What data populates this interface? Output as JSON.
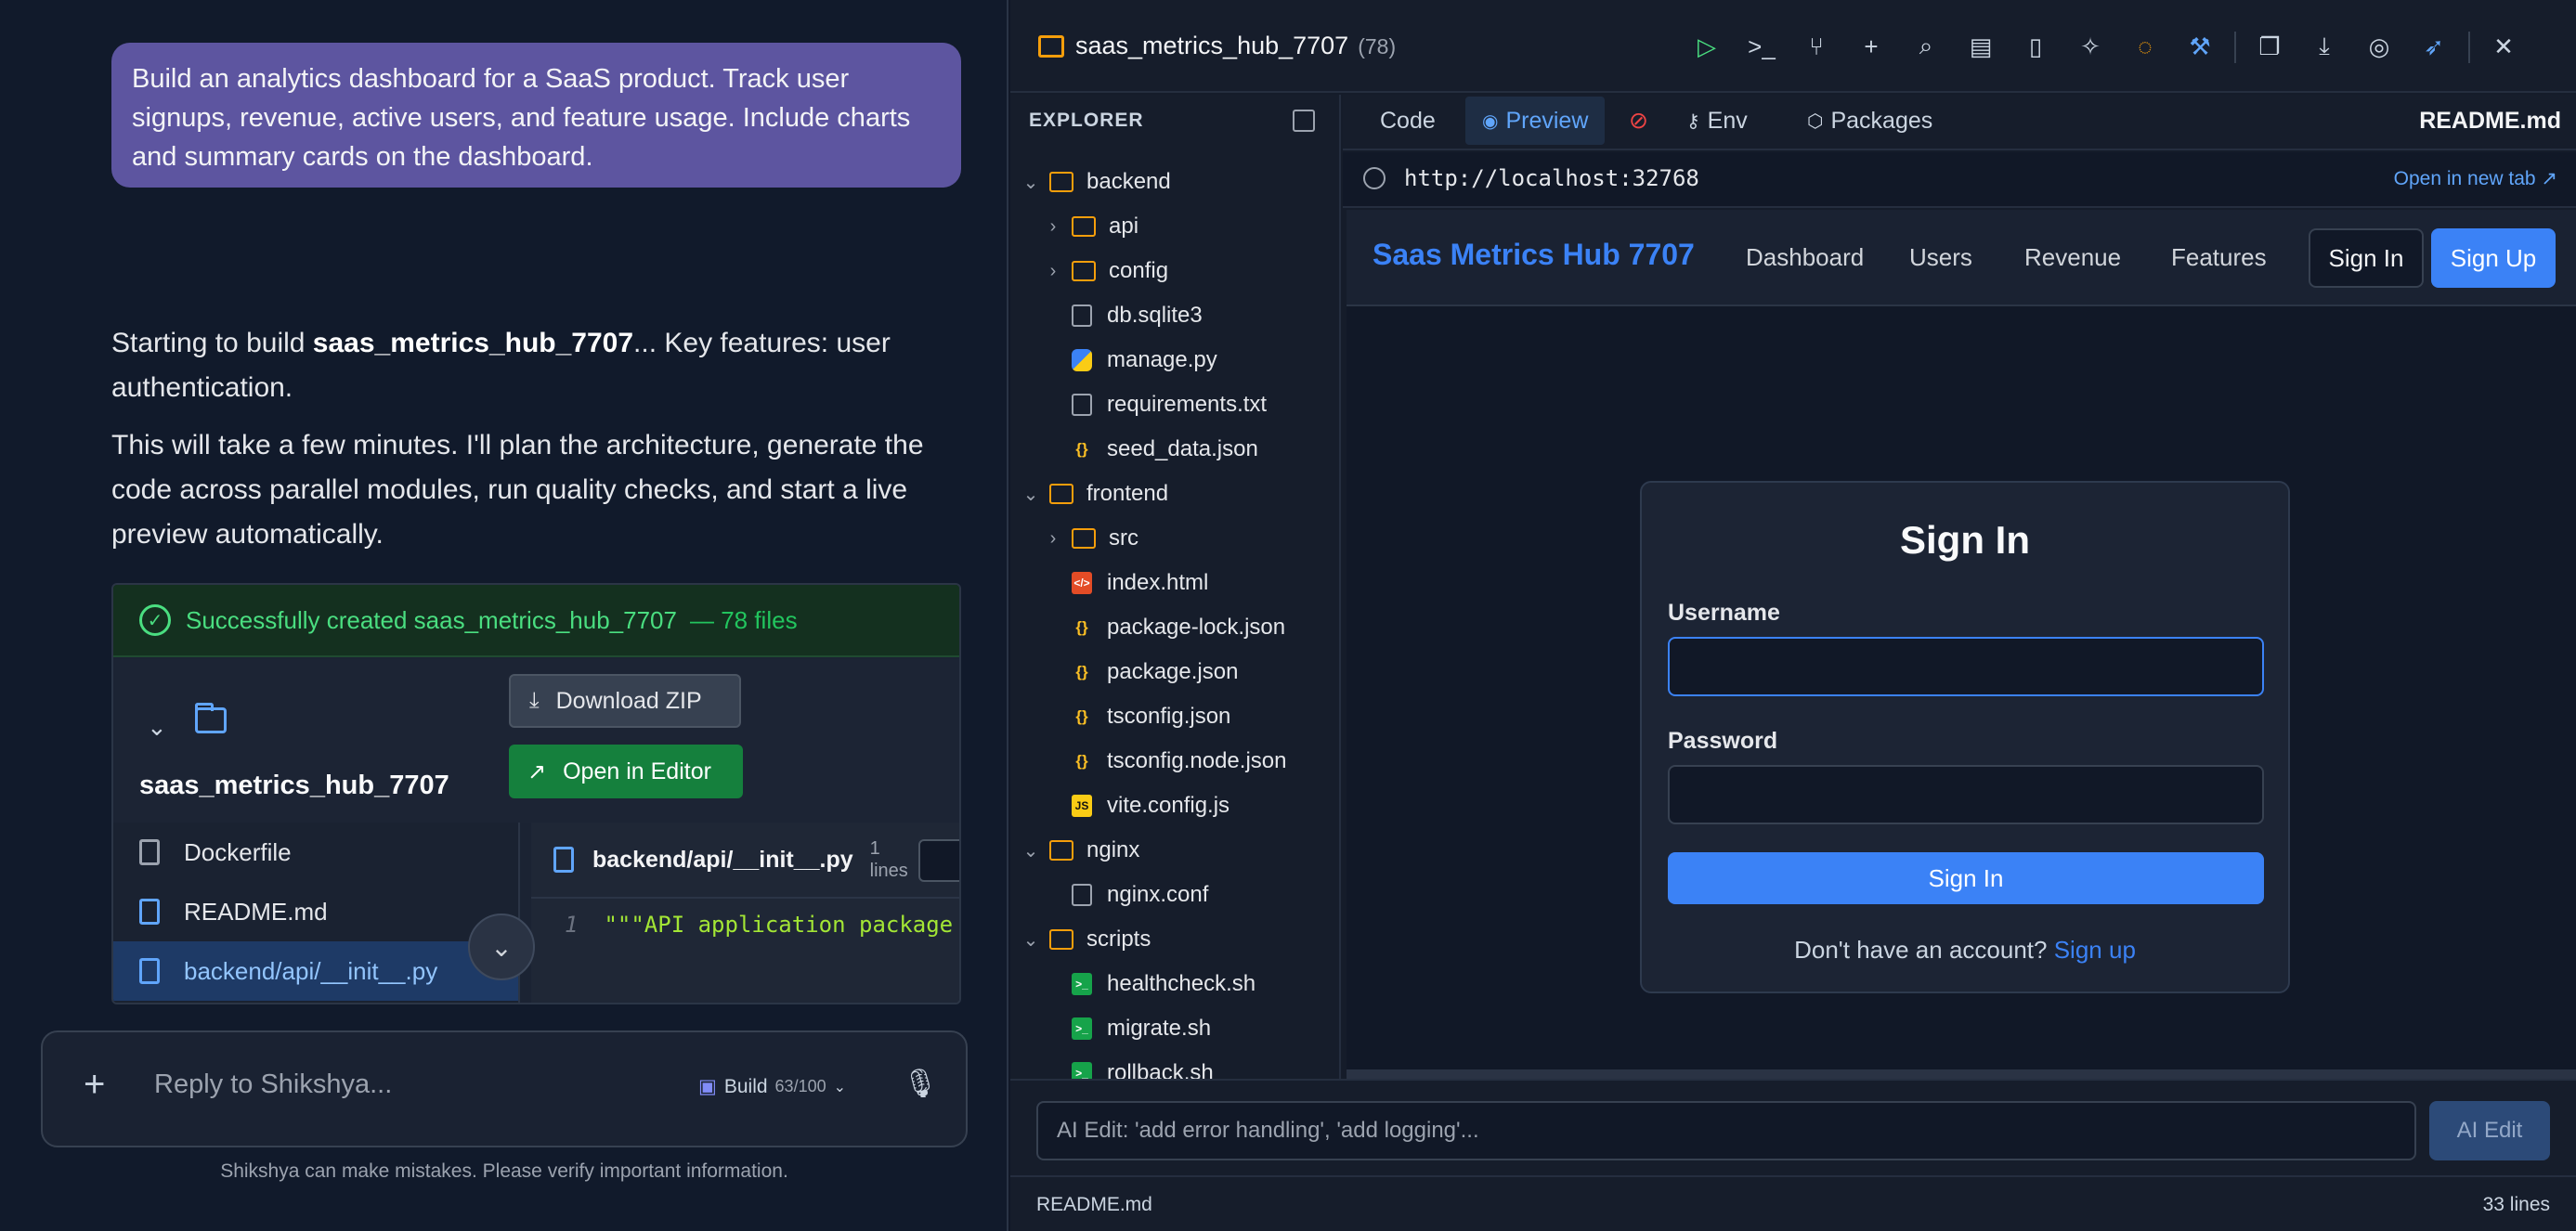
{
  "chat": {
    "user_message": "Build an analytics dashboard for a SaaS product. Track user signups, revenue, active users, and feature usage. Include charts and summary cards on the dashboard.",
    "p1_prefix": "Starting to build ",
    "p1_project": "saas_metrics_hub_7707",
    "p1_suffix": "... Key features: user authentication.",
    "p2": "This will take a few minutes. I'll plan the architecture, generate the code across parallel modules, run quality checks, and start a live preview automatically.",
    "card": {
      "status": "Successfully created saas_metrics_hub_7707",
      "file_count": "— 78 files",
      "project_name": "saas_metrics_hub_7707",
      "download_label": "Download ZIP",
      "open_editor_label": "Open in Editor",
      "files": [
        {
          "name": "Dockerfile"
        },
        {
          "name": "README.md"
        },
        {
          "name": "backend/api/__init__.py"
        }
      ],
      "code": {
        "path": "backend/api/__init__.py",
        "lines_count": "1",
        "lines_label": "lines",
        "line_no": "1",
        "line_text": "\"\"\"API application package"
      }
    },
    "reply_placeholder": "Reply to Shikshya...",
    "build_label": "Build",
    "build_count": "63/100",
    "disclaimer": "Shikshya can make mistakes. Please verify important information."
  },
  "ide": {
    "title": "saas_metrics_hub_7707",
    "count": "(78)",
    "toolbar_icons": [
      "play-icon",
      "terminal-icon",
      "git-branch-icon",
      "plus-icon",
      "search-icon",
      "clipboard-icon",
      "test-tube-icon",
      "magic-wand-icon",
      "lightbulb-icon",
      "wrench-icon",
      "copy-icon",
      "download-icon",
      "github-icon",
      "rocket-icon",
      "close-icon"
    ],
    "explorer_title": "EXPLORER",
    "tree": [
      {
        "label": "backend",
        "kind": "folder",
        "open": true,
        "depth": 0
      },
      {
        "label": "api",
        "kind": "folder",
        "open": false,
        "depth": 1
      },
      {
        "label": "config",
        "kind": "folder",
        "open": false,
        "depth": 1
      },
      {
        "label": "db.sqlite3",
        "kind": "doc",
        "depth": 1
      },
      {
        "label": "manage.py",
        "kind": "py",
        "depth": 1
      },
      {
        "label": "requirements.txt",
        "kind": "doc",
        "depth": 1
      },
      {
        "label": "seed_data.json",
        "kind": "json",
        "depth": 1
      },
      {
        "label": "frontend",
        "kind": "folder",
        "open": true,
        "depth": 0
      },
      {
        "label": "src",
        "kind": "folder",
        "open": false,
        "depth": 1
      },
      {
        "label": "index.html",
        "kind": "html",
        "depth": 1
      },
      {
        "label": "package-lock.json",
        "kind": "json",
        "depth": 1
      },
      {
        "label": "package.json",
        "kind": "json",
        "depth": 1
      },
      {
        "label": "tsconfig.json",
        "kind": "json",
        "depth": 1
      },
      {
        "label": "tsconfig.node.json",
        "kind": "json",
        "depth": 1
      },
      {
        "label": "vite.config.js",
        "kind": "js",
        "depth": 1
      },
      {
        "label": "nginx",
        "kind": "folder",
        "open": true,
        "depth": 0
      },
      {
        "label": "nginx.conf",
        "kind": "doc",
        "depth": 1
      },
      {
        "label": "scripts",
        "kind": "folder",
        "open": true,
        "depth": 0
      },
      {
        "label": "healthcheck.sh",
        "kind": "sh",
        "depth": 1
      },
      {
        "label": "migrate.sh",
        "kind": "sh",
        "depth": 1
      },
      {
        "label": "rollback.sh",
        "kind": "sh",
        "depth": 1
      }
    ],
    "tabs": {
      "code": "Code",
      "preview": "Preview",
      "env": "Env",
      "packages": "Packages",
      "open_file": "README.md"
    },
    "url": "http://localhost:32768",
    "open_new_tab": "Open in new tab ↗",
    "app": {
      "brand": "Saas Metrics Hub 7707",
      "nav": [
        "Dashboard",
        "Users",
        "Revenue",
        "Features"
      ],
      "sign_in": "Sign In",
      "sign_up": "Sign Up",
      "login": {
        "title": "Sign In",
        "username_label": "Username",
        "username_value": "",
        "password_label": "Password",
        "password_value": "",
        "submit": "Sign In",
        "footer_text": "Don't have an account?",
        "footer_link": "Sign up"
      }
    },
    "ai_placeholder": "AI Edit: 'add error handling', 'add logging'...",
    "ai_button": "AI Edit",
    "status_file": "README.md",
    "status_lines": "33 lines",
    "colors": {
      "accent": "#3b82f6",
      "success": "#4ade80",
      "user_bubble": "#5d55a0",
      "folder": "#f59e0b"
    }
  }
}
